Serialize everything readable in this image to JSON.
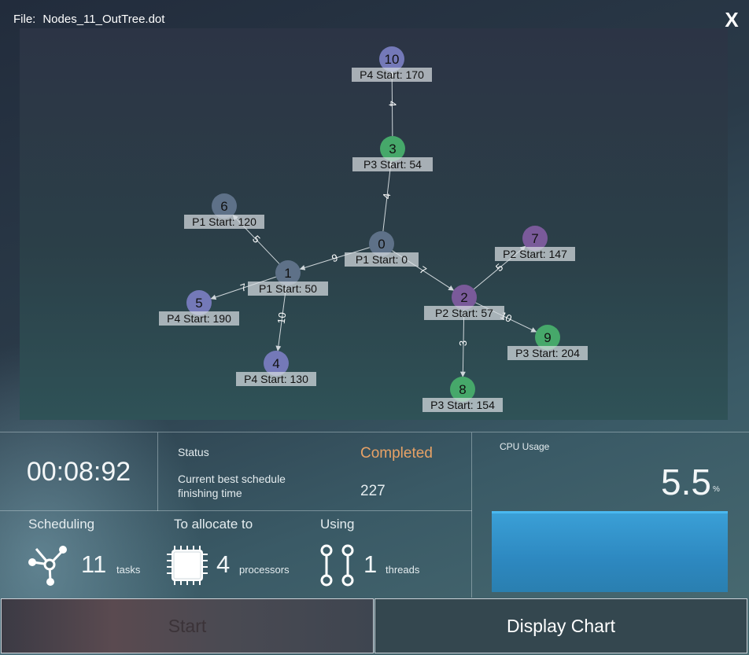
{
  "header": {
    "file_label": "File:",
    "file_name": "Nodes_11_OutTree.dot",
    "close_label": "X"
  },
  "graph": {
    "nodes": [
      {
        "id": "0",
        "label": "P1   Start: 0",
        "color": "#5e7188"
      },
      {
        "id": "1",
        "label": "P1   Start: 50",
        "color": "#5e7188"
      },
      {
        "id": "2",
        "label": "P2   Start: 57",
        "color": "#7a5a9a"
      },
      {
        "id": "3",
        "label": "P3   Start: 54",
        "color": "#46a86a"
      },
      {
        "id": "4",
        "label": "P4   Start: 130",
        "color": "#7479b8"
      },
      {
        "id": "5",
        "label": "P4   Start: 190",
        "color": "#7479b8"
      },
      {
        "id": "6",
        "label": "P1   Start: 120",
        "color": "#5e7188"
      },
      {
        "id": "7",
        "label": "P2   Start: 147",
        "color": "#7a5a9a"
      },
      {
        "id": "8",
        "label": "P3   Start: 154",
        "color": "#46a86a"
      },
      {
        "id": "9",
        "label": "P3   Start: 204",
        "color": "#46a86a"
      },
      {
        "id": "10",
        "label": "P4   Start: 170",
        "color": "#7479b8"
      }
    ],
    "edges": [
      {
        "from": "0",
        "to": "3",
        "weight": "4"
      },
      {
        "from": "3",
        "to": "10",
        "weight": "4"
      },
      {
        "from": "0",
        "to": "1",
        "weight": "9"
      },
      {
        "from": "0",
        "to": "2",
        "weight": "7"
      },
      {
        "from": "1",
        "to": "6",
        "weight": "5"
      },
      {
        "from": "1",
        "to": "5",
        "weight": "7"
      },
      {
        "from": "1",
        "to": "4",
        "weight": "10"
      },
      {
        "from": "2",
        "to": "7",
        "weight": "5"
      },
      {
        "from": "2",
        "to": "9",
        "weight": "10"
      },
      {
        "from": "2",
        "to": "8",
        "weight": "3"
      }
    ]
  },
  "timer": "00:08:92",
  "status": {
    "title": "Status",
    "value": "Completed",
    "value_color": "#e8a266",
    "best_title": "Current best schedule finishing time",
    "best_value": "227"
  },
  "cpu": {
    "title": "CPU Usage",
    "value": "5.5",
    "unit": "%",
    "usage_percent": 5.5
  },
  "stats": {
    "scheduling": {
      "title": "Scheduling",
      "value": "11",
      "unit": "tasks",
      "icon": "tree-icon"
    },
    "allocate": {
      "title": "To allocate to",
      "value": "4",
      "unit": "processors",
      "icon": "processor-chip-icon"
    },
    "using": {
      "title": "Using",
      "value": "1",
      "unit": "threads",
      "icon": "threads-icon"
    }
  },
  "buttons": {
    "start": "Start",
    "display_chart": "Display Chart"
  }
}
